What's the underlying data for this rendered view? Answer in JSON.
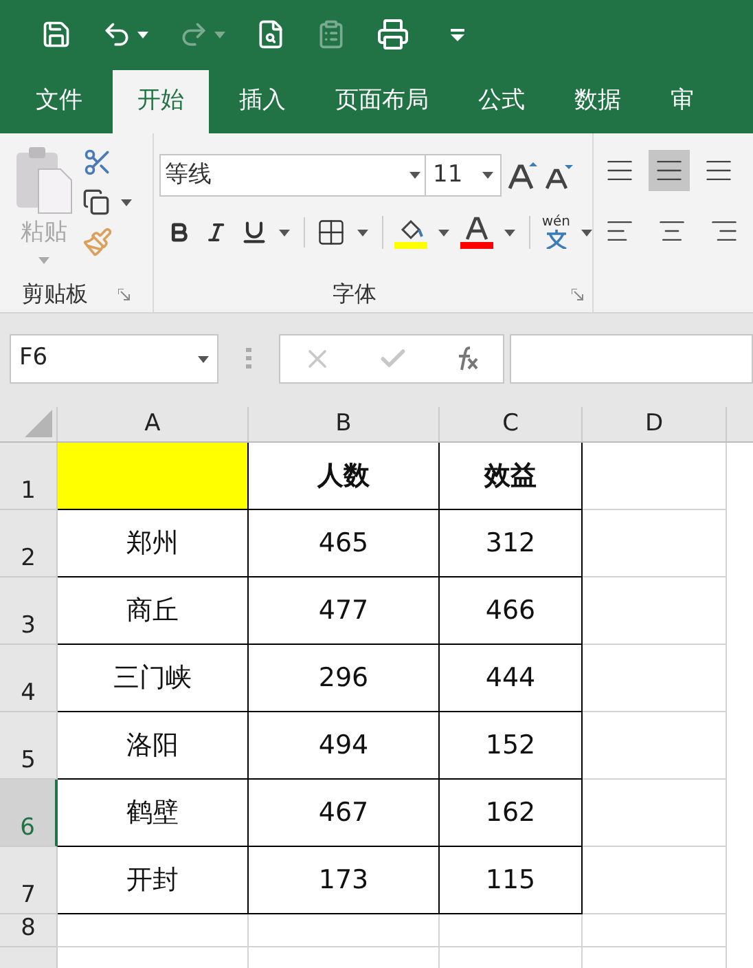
{
  "tabs": [
    {
      "label": "文件",
      "selected": false
    },
    {
      "label": "开始",
      "selected": true
    },
    {
      "label": "插入",
      "selected": false
    },
    {
      "label": "页面布局",
      "selected": false
    },
    {
      "label": "公式",
      "selected": false
    },
    {
      "label": "数据",
      "selected": false
    },
    {
      "label": "审",
      "selected": false
    }
  ],
  "ribbon": {
    "paste_label": "粘贴",
    "clipboard_group": "剪贴板",
    "font_name": "等线",
    "font_size": "11",
    "font_group": "字体",
    "phonetic_label": "wén"
  },
  "name_box": {
    "value": "F6"
  },
  "columns": [
    "A",
    "B",
    "C",
    "D"
  ],
  "rows": [
    {
      "number": "1",
      "selected": false,
      "kind": "header",
      "cells": [
        {
          "text": "",
          "highlighted": true
        },
        {
          "text": "人数",
          "highlighted": false
        },
        {
          "text": "效益",
          "highlighted": false
        }
      ]
    },
    {
      "number": "2",
      "selected": false,
      "kind": "data",
      "cells": [
        {
          "text": "郑州",
          "highlighted": false
        },
        {
          "text": "465",
          "highlighted": false
        },
        {
          "text": "312",
          "highlighted": false
        }
      ]
    },
    {
      "number": "3",
      "selected": false,
      "kind": "data",
      "cells": [
        {
          "text": "商丘",
          "highlighted": false
        },
        {
          "text": "477",
          "highlighted": false
        },
        {
          "text": "466",
          "highlighted": false
        }
      ]
    },
    {
      "number": "4",
      "selected": false,
      "kind": "data",
      "cells": [
        {
          "text": "三门峡",
          "highlighted": false
        },
        {
          "text": "296",
          "highlighted": false
        },
        {
          "text": "444",
          "highlighted": false
        }
      ]
    },
    {
      "number": "5",
      "selected": false,
      "kind": "data",
      "cells": [
        {
          "text": "洛阳",
          "highlighted": false
        },
        {
          "text": "494",
          "highlighted": false
        },
        {
          "text": "152",
          "highlighted": false
        }
      ]
    },
    {
      "number": "6",
      "selected": true,
      "kind": "data",
      "cells": [
        {
          "text": "鹤壁",
          "highlighted": false
        },
        {
          "text": "467",
          "highlighted": false
        },
        {
          "text": "162",
          "highlighted": false
        }
      ]
    },
    {
      "number": "7",
      "selected": false,
      "kind": "data",
      "cells": [
        {
          "text": "开封",
          "highlighted": false
        },
        {
          "text": "173",
          "highlighted": false
        },
        {
          "text": "115",
          "highlighted": false
        }
      ]
    },
    {
      "number": "8",
      "selected": false,
      "kind": "empty",
      "cells": []
    }
  ]
}
